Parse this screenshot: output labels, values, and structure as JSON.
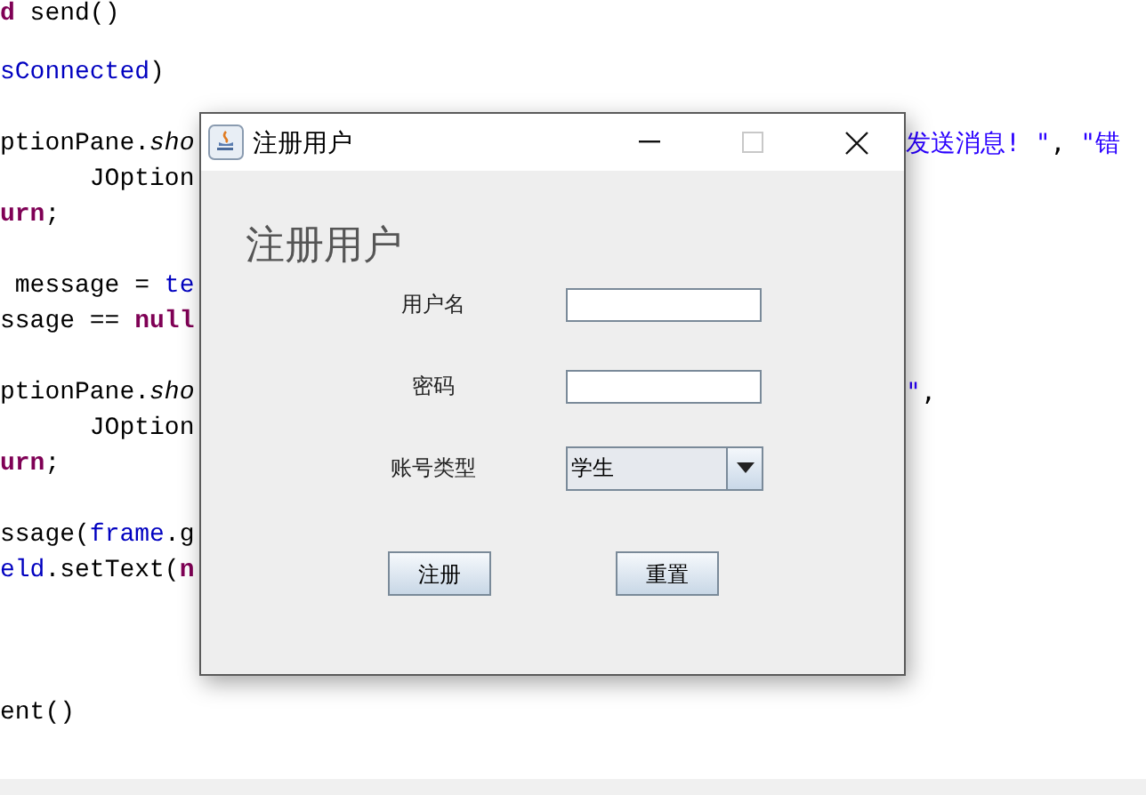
{
  "editor": {
    "blocks": [
      {
        "lines": [
          {
            "left": [
              {
                "text": "d",
                "kind": "keyword"
              },
              {
                "text": " send()",
                "kind": "plain"
              }
            ]
          }
        ]
      },
      {
        "lines": [
          {
            "left": [
              {
                "text": "sConnected",
                "kind": "field"
              },
              {
                "text": ")",
                "kind": "plain"
              }
            ]
          }
        ]
      },
      {
        "lines": [
          {
            "left": [
              {
                "text": "ptionPane.",
                "kind": "plain"
              },
              {
                "text": "sho",
                "kind": "italic"
              }
            ],
            "right": [
              {
                "text": "发送消息! \"",
                "kind": "string"
              },
              {
                "text": ", ",
                "kind": "plain"
              },
              {
                "text": "\"错",
                "kind": "string"
              }
            ]
          },
          {
            "left": [
              {
                "text": "      JOption",
                "kind": "plain"
              }
            ]
          },
          {
            "left": [
              {
                "text": "urn",
                "kind": "keyword"
              },
              {
                "text": ";",
                "kind": "plain"
              }
            ]
          }
        ]
      },
      {
        "lines": [
          {
            "left": [
              {
                "text": " message = ",
                "kind": "plain"
              },
              {
                "text": "te",
                "kind": "field"
              }
            ]
          },
          {
            "left": [
              {
                "text": "ssage == ",
                "kind": "plain"
              },
              {
                "text": "null",
                "kind": "keyword"
              }
            ]
          }
        ]
      },
      {
        "lines": [
          {
            "left": [
              {
                "text": "ptionPane.",
                "kind": "plain"
              },
              {
                "text": "sho",
                "kind": "italic"
              }
            ],
            "right": [
              {
                "text": "\"",
                "kind": "string"
              },
              {
                "text": ",",
                "kind": "plain"
              }
            ]
          },
          {
            "left": [
              {
                "text": "      JOption",
                "kind": "plain"
              }
            ]
          },
          {
            "left": [
              {
                "text": "urn",
                "kind": "keyword"
              },
              {
                "text": ";",
                "kind": "plain"
              }
            ]
          }
        ]
      },
      {
        "lines": [
          {
            "left": [
              {
                "text": "ssage(",
                "kind": "plain"
              },
              {
                "text": "frame",
                "kind": "field"
              },
              {
                "text": ".g",
                "kind": "plain"
              }
            ]
          },
          {
            "left": [
              {
                "text": "eld",
                "kind": "field"
              },
              {
                "text": ".setText(",
                "kind": "plain"
              },
              {
                "text": "n",
                "kind": "keyword"
              }
            ]
          }
        ]
      },
      {
        "lines": [
          {
            "left": [
              {
                "text": "ent()",
                "kind": "plain"
              }
            ]
          }
        ]
      }
    ]
  },
  "dialog": {
    "title": "注册用户",
    "heading": "注册用户",
    "fields": [
      {
        "kind": "text",
        "label": "用户名"
      },
      {
        "kind": "text",
        "label": "密码"
      },
      {
        "kind": "combo",
        "label": "账号类型",
        "value": "学生"
      }
    ],
    "buttons": [
      "注册",
      "重置"
    ]
  }
}
